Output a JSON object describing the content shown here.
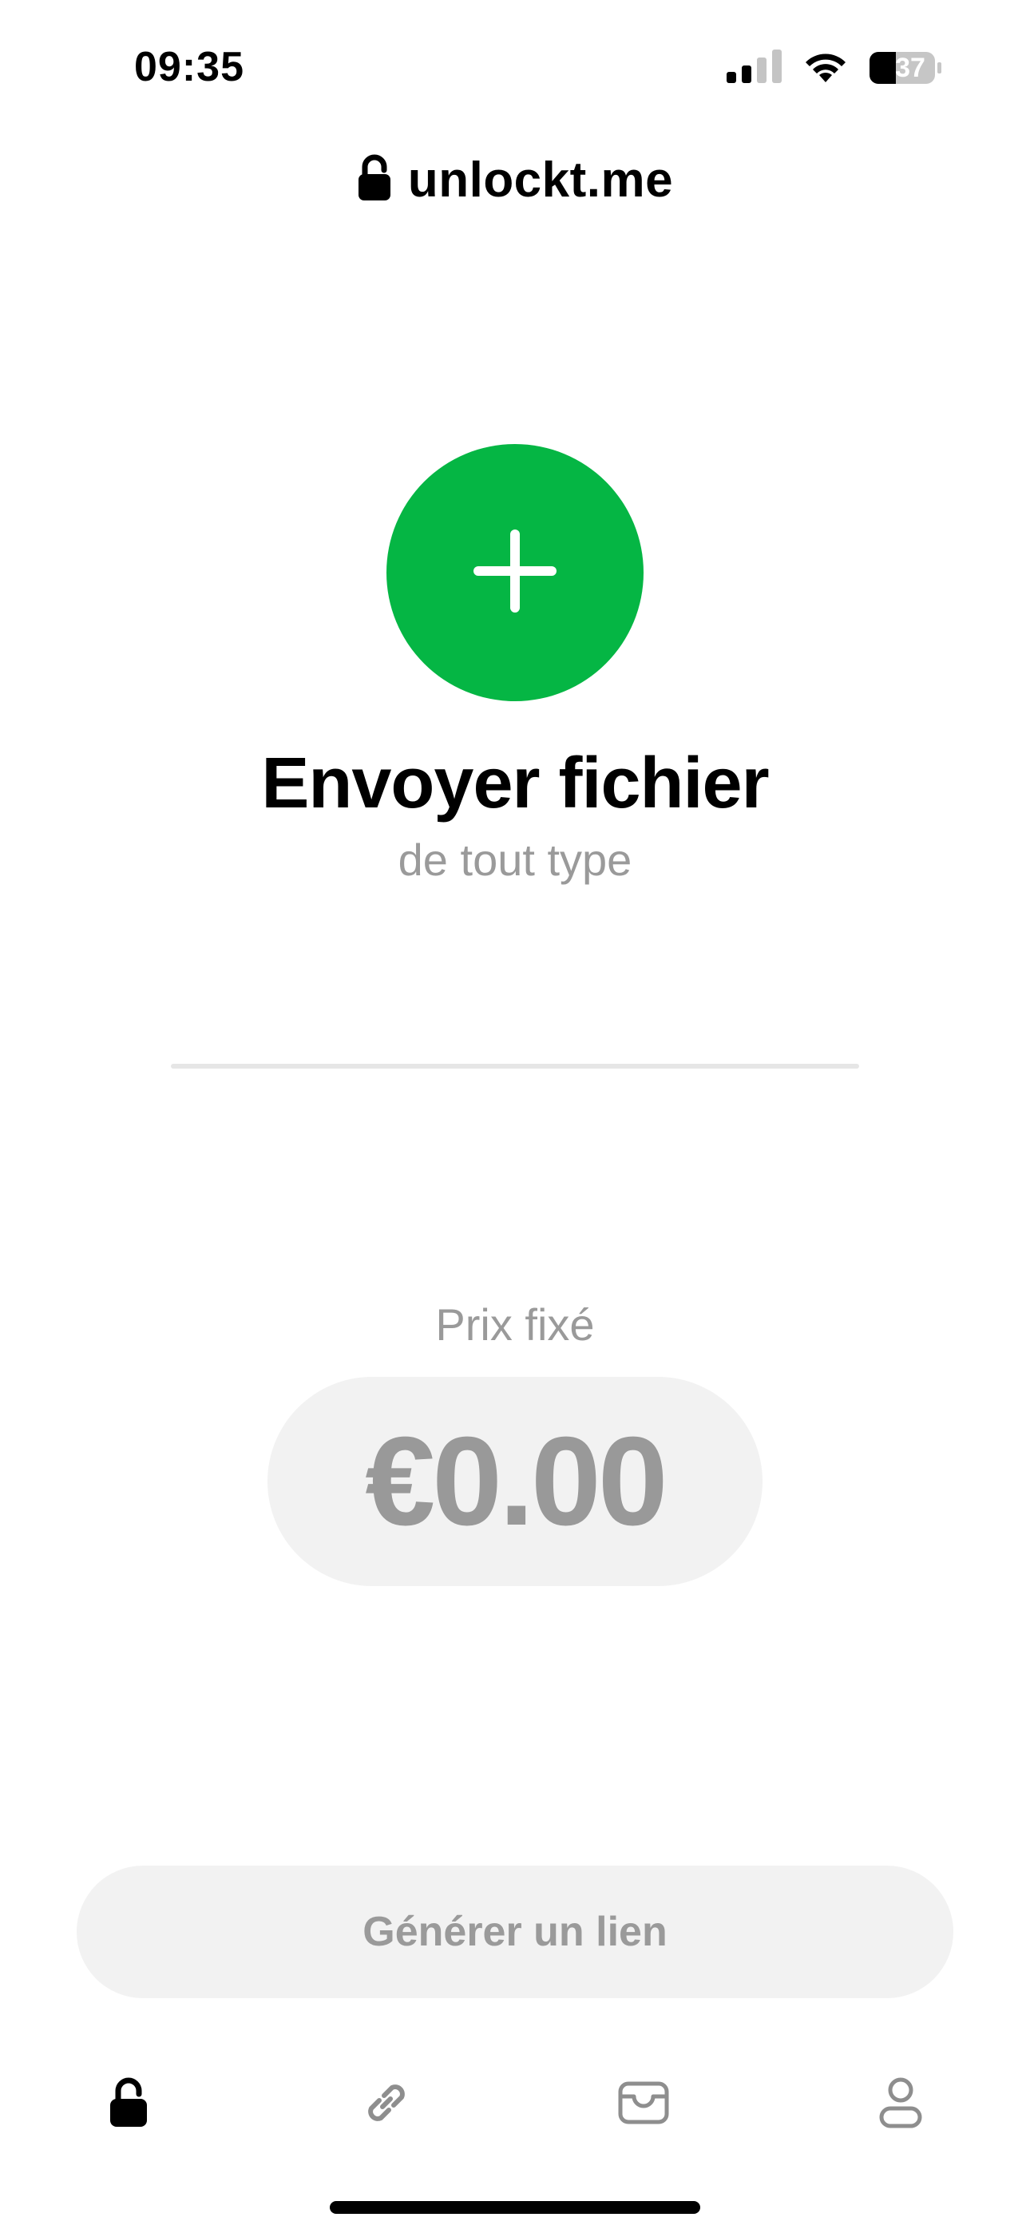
{
  "status_bar": {
    "time": "09:35",
    "battery": "37",
    "icons": [
      "cellular-signal-icon",
      "wifi-icon",
      "battery-icon"
    ]
  },
  "header": {
    "brand": "unlockt.me",
    "icon": "lock-icon"
  },
  "upload": {
    "icon": "plus-icon",
    "title": "Envoyer fichier",
    "subtitle": "de tout type"
  },
  "price": {
    "label": "Prix fixé",
    "value": "€0.00"
  },
  "actions": {
    "generate_label": "Générer un lien"
  },
  "tab_bar": {
    "items": [
      {
        "icon": "lock-icon",
        "active": true
      },
      {
        "icon": "link-icon",
        "active": false
      },
      {
        "icon": "wallet-icon",
        "active": false
      },
      {
        "icon": "profile-icon",
        "active": false
      }
    ]
  },
  "colors": {
    "accent": "#05b644",
    "muted_text": "#9a9a9a",
    "pill_background": "#f2f2f2",
    "inactive_icon": "#8e8e8e"
  }
}
